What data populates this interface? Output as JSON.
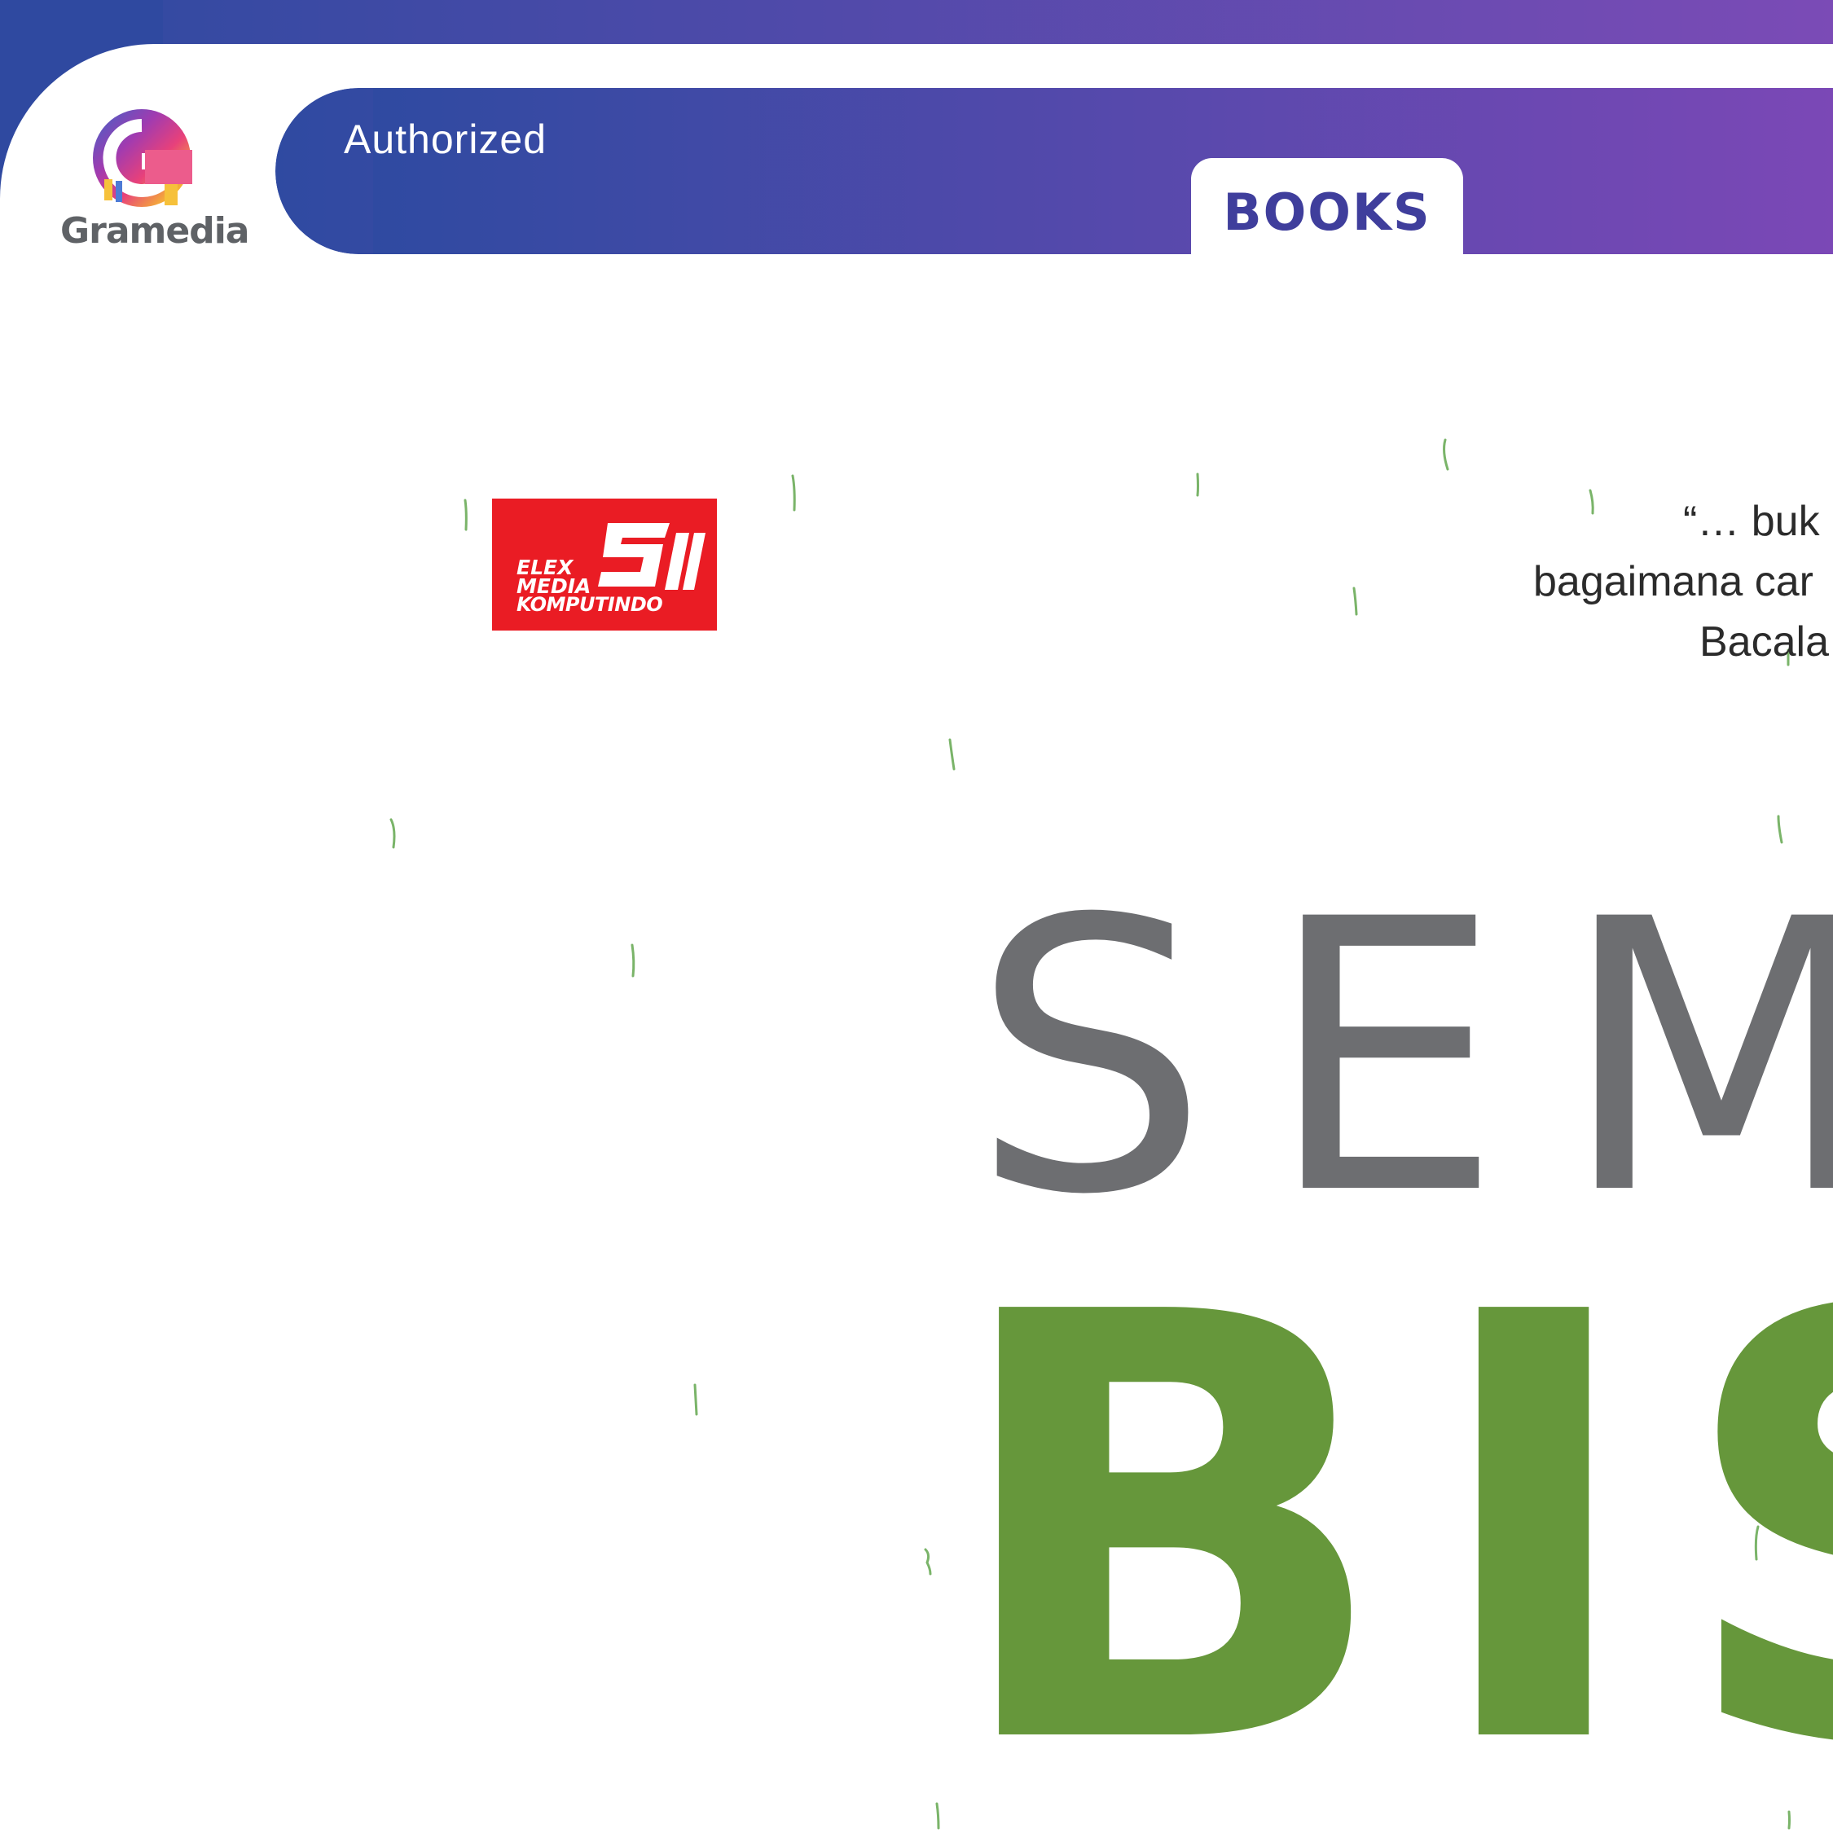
{
  "brand": {
    "name": "Gramedia",
    "badge": "Authorized",
    "tab": "BOOKS",
    "gradient_start": "#2e4aa0",
    "gradient_end": "#7b4bb6",
    "logo_icon": "gramedia-g-logo-icon"
  },
  "publisher": {
    "lines": [
      "ELEX",
      "MEDIA",
      "KOMPUTINDO"
    ],
    "color": "#ea1c24",
    "icon": "elex-media-logo-icon"
  },
  "quote": {
    "lines": [
      "“… buk",
      "bagaimana car",
      "Bacala"
    ]
  },
  "title": {
    "line1": "SEMU",
    "line2": "BIS",
    "line1_color": "#6d6e71",
    "line2_color": "#66973b"
  },
  "decoration": {
    "rain_icon": "rain-stroke-icon",
    "rain_color": "#7ab469"
  }
}
